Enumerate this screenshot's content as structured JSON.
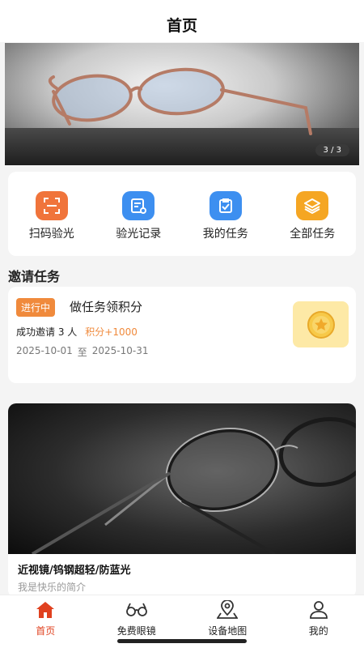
{
  "header": {
    "title": "首页"
  },
  "banner": {
    "indicator": "3 / 3"
  },
  "quick_actions": [
    {
      "label": "扫码验光",
      "icon": "scan-icon",
      "color": "#f0743b"
    },
    {
      "label": "验光记录",
      "icon": "record-icon",
      "color": "#3d8ff0"
    },
    {
      "label": "我的任务",
      "icon": "task-check-icon",
      "color": "#3d8ff0"
    },
    {
      "label": "全部任务",
      "icon": "stack-icon",
      "color": "#f5a623"
    }
  ],
  "section": {
    "invite_title": "邀请任务"
  },
  "task": {
    "status": "进行中",
    "title": "做任务领积分",
    "invite_text": "成功邀请 3 人",
    "points": "积分+1000",
    "start_date": "2025-10-01",
    "date_sep": "至",
    "end_date": "2025-10-31",
    "icon": "coin-icon"
  },
  "product": {
    "title": "近视镜/钨钢超轻/防蓝光",
    "description": "我是快乐的简介"
  },
  "tabbar": {
    "items": [
      {
        "label": "首页",
        "icon": "home-icon",
        "active": true
      },
      {
        "label": "免费眼镜",
        "icon": "glasses-icon",
        "active": false
      },
      {
        "label": "设备地图",
        "icon": "map-pin-icon",
        "active": false
      },
      {
        "label": "我的",
        "icon": "user-icon",
        "active": false
      }
    ],
    "active_color": "#e0411f"
  }
}
